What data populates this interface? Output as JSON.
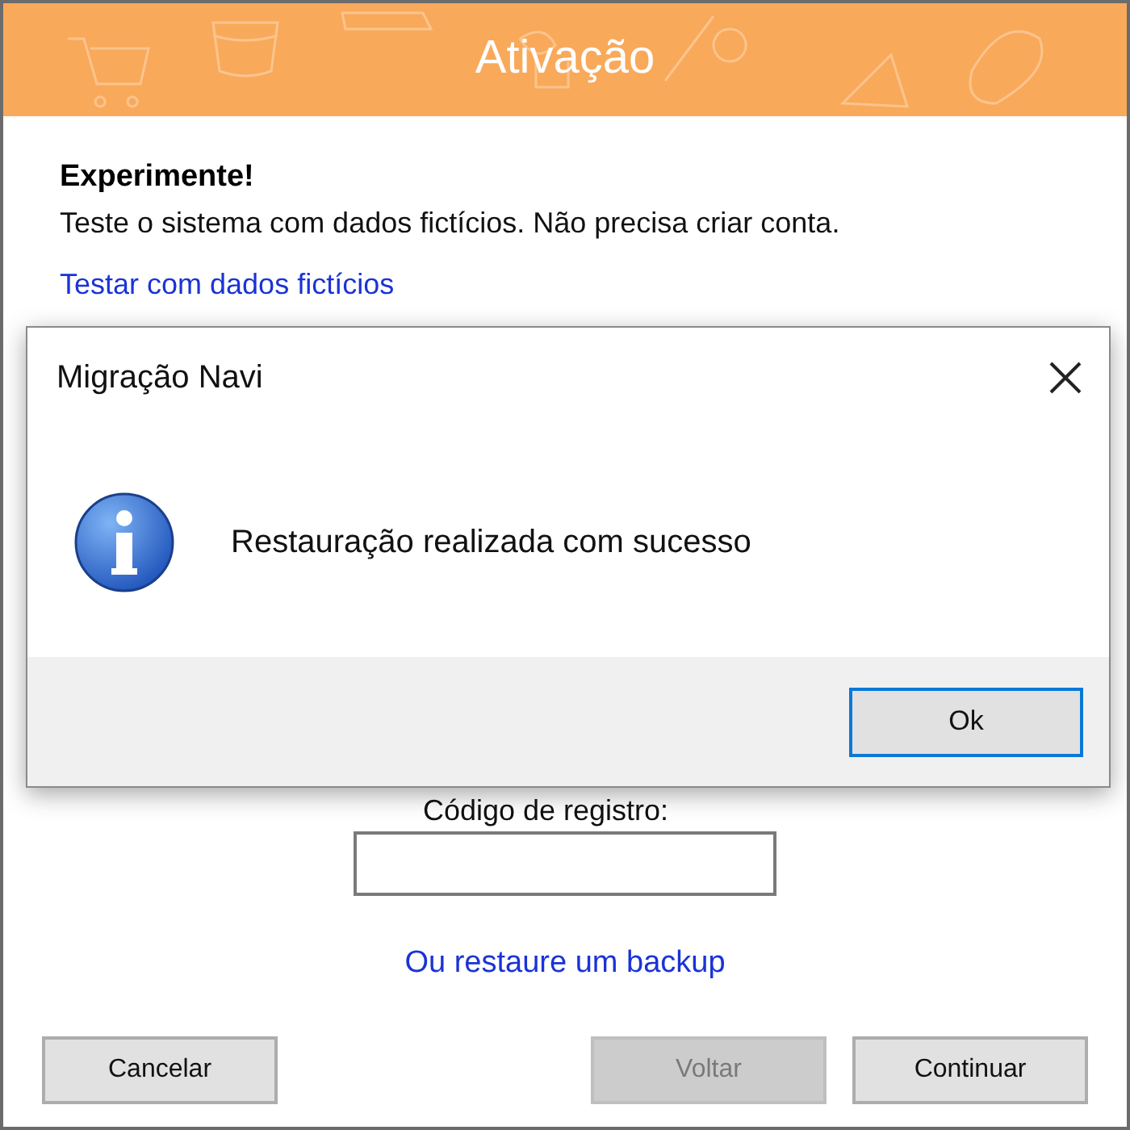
{
  "header": {
    "title": "Ativação"
  },
  "trial": {
    "heading": "Experimente!",
    "text": "Teste o sistema com dados fictícios. Não precisa criar conta.",
    "link": "Testar com dados fictícios"
  },
  "registration": {
    "label": "Código de registro:"
  },
  "restore_link": "Ou restaure um backup",
  "buttons": [
    {
      "label": "Cancelar",
      "disabled": false
    },
    {
      "label": "Voltar",
      "disabled": true
    },
    {
      "label": "Continuar",
      "disabled": false
    }
  ],
  "dialog": {
    "title": "Migração Navi",
    "message": "Restauração realizada com sucesso",
    "ok_button": {
      "label": "Ok",
      "focused": true
    }
  }
}
